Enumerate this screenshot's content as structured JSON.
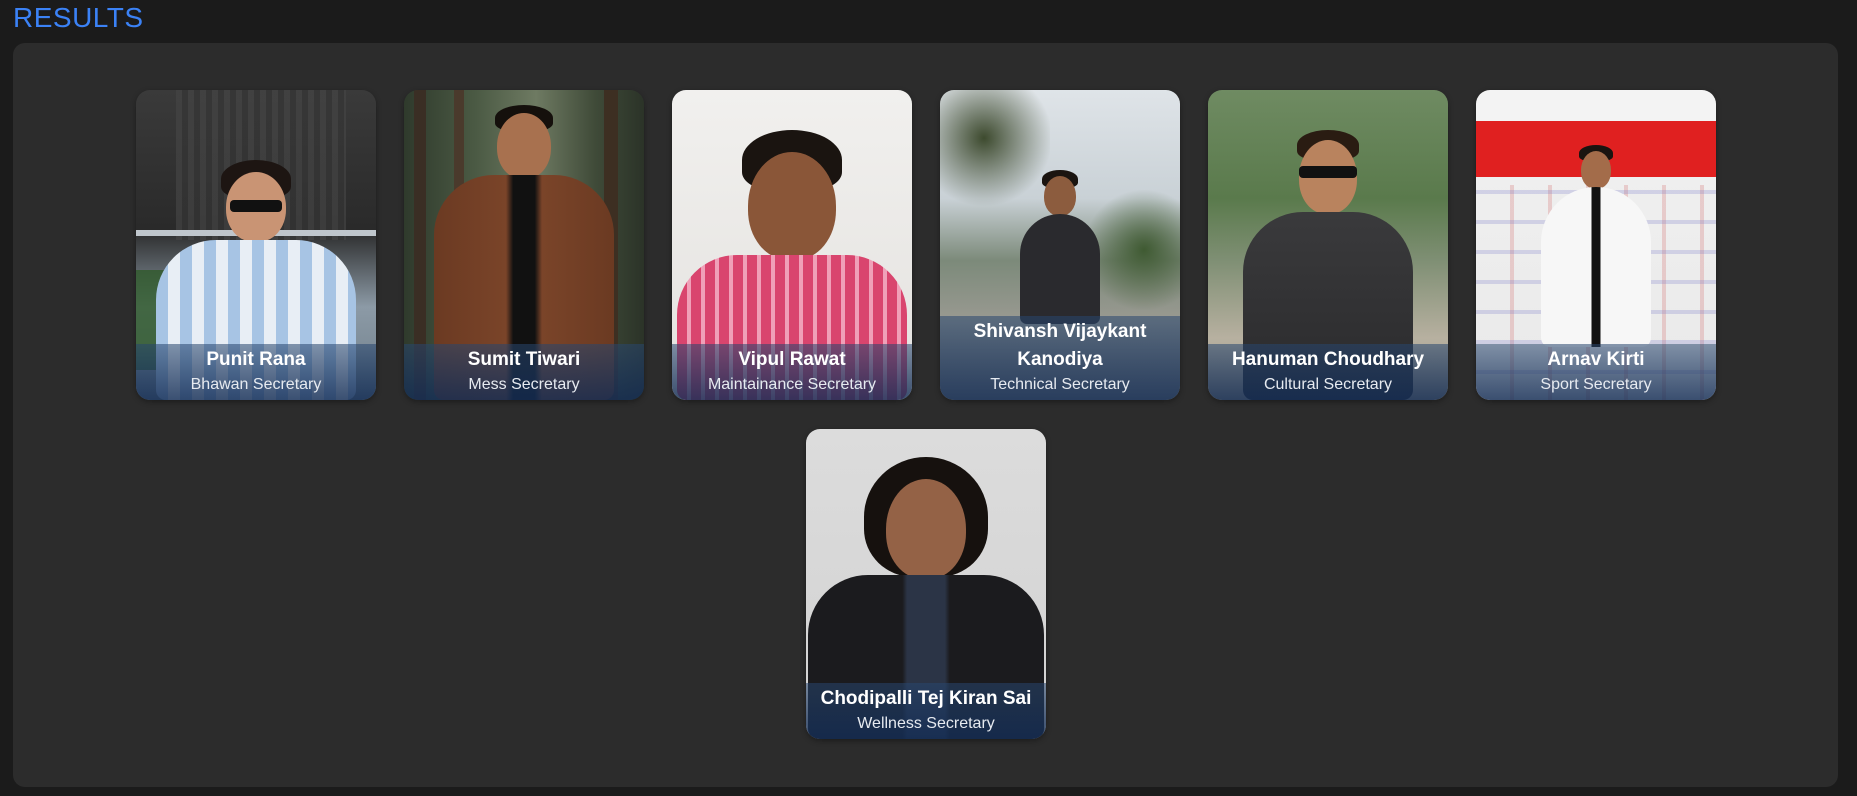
{
  "page": {
    "title": "RESULTS"
  },
  "members": [
    {
      "name": "Punit Rana",
      "role": "Bhawan Secretary"
    },
    {
      "name": "Sumit Tiwari",
      "role": "Mess Secretary"
    },
    {
      "name": "Vipul Rawat",
      "role": "Maintainance Secretary"
    },
    {
      "name": "Shivansh Vijaykant Kanodiya",
      "role": "Technical Secretary"
    },
    {
      "name": "Hanuman Choudhary",
      "role": "Cultural Secretary"
    },
    {
      "name": "Arnav Kirti",
      "role": "Sport Secretary"
    },
    {
      "name": "Chodipalli Tej Kiran Sai",
      "role": "Wellness Secretary"
    }
  ],
  "colors": {
    "accent": "#3b82f6",
    "background": "#1b1b1b",
    "panel": "#2c2c2c"
  }
}
